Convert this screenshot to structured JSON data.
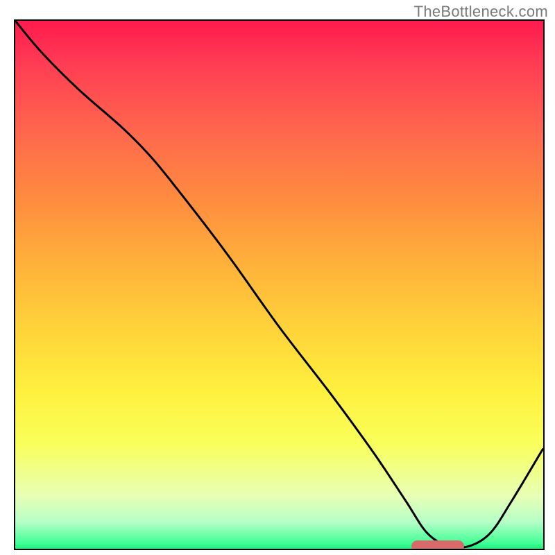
{
  "watermark": "TheBottleneck.com",
  "colors": {
    "frame": "#000000",
    "curve": "#000000",
    "marker": "#d86a6a",
    "gradient_top": "#ff1a4d",
    "gradient_bottom": "#18f07e"
  },
  "chart_data": {
    "type": "line",
    "title": "",
    "xlabel": "",
    "ylabel": "",
    "xlim": [
      0,
      100
    ],
    "ylim": [
      0,
      100
    ],
    "note": "No axis tick values are rendered in the image; coordinates below are normalized to the plot box (0–100 on each axis, y increases upward).",
    "series": [
      {
        "name": "bottleneck-curve",
        "x": [
          0,
          5,
          12,
          20,
          25,
          30,
          40,
          50,
          60,
          68,
          74,
          78,
          82,
          86,
          90,
          94,
          100
        ],
        "y": [
          100,
          94,
          87,
          80,
          75,
          69,
          56,
          42,
          29,
          18,
          9,
          3,
          0.5,
          0.5,
          3,
          9,
          19
        ]
      }
    ],
    "annotations": [
      {
        "name": "optimal-marker",
        "shape": "rounded-bar",
        "x_center": 80,
        "y_center": 0.5,
        "width_x_units": 10,
        "color": "#d86a6a"
      }
    ]
  }
}
